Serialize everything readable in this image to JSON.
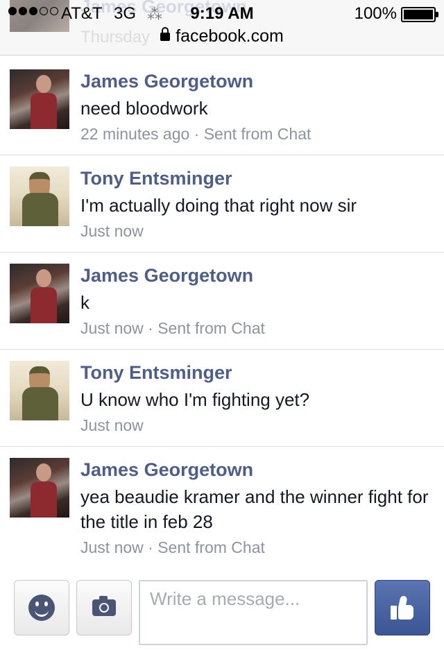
{
  "status_bar": {
    "signal_dots_filled": 3,
    "signal_dots_total": 5,
    "carrier": "AT&T",
    "network": "3G",
    "time": "9:19 AM",
    "battery": "100%",
    "battery_level": 1.0,
    "url": "facebook.com"
  },
  "scrolled_partial": {
    "name": "James Georgetown",
    "time": "Thursday"
  },
  "messages": [
    {
      "sender": "James Georgetown",
      "text": "need bloodwork",
      "meta": "22 minutes ago · Sent from Chat"
    },
    {
      "sender": "Tony Entsminger",
      "text": "I'm actually doing that right now sir",
      "meta": "Just now"
    },
    {
      "sender": "James Georgetown",
      "text": "k",
      "meta": "Just now · Sent from Chat"
    },
    {
      "sender": "Tony Entsminger",
      "text": "U know who I'm fighting yet?",
      "meta": "Just now"
    },
    {
      "sender": "James Georgetown",
      "text": "yea beaudie kramer and the winner fight for the title in feb 28",
      "meta": "Just now · Sent from Chat"
    }
  ],
  "composer": {
    "placeholder": "Write a message...",
    "value": ""
  },
  "icons": {
    "emoji": "smiley-icon",
    "photo": "camera-icon",
    "like": "thumbs-up-icon",
    "secure": "lock-icon"
  },
  "colors": {
    "name_link": "#4e5e86",
    "meta_text": "#8d949e",
    "like_button": "#3b5595"
  }
}
